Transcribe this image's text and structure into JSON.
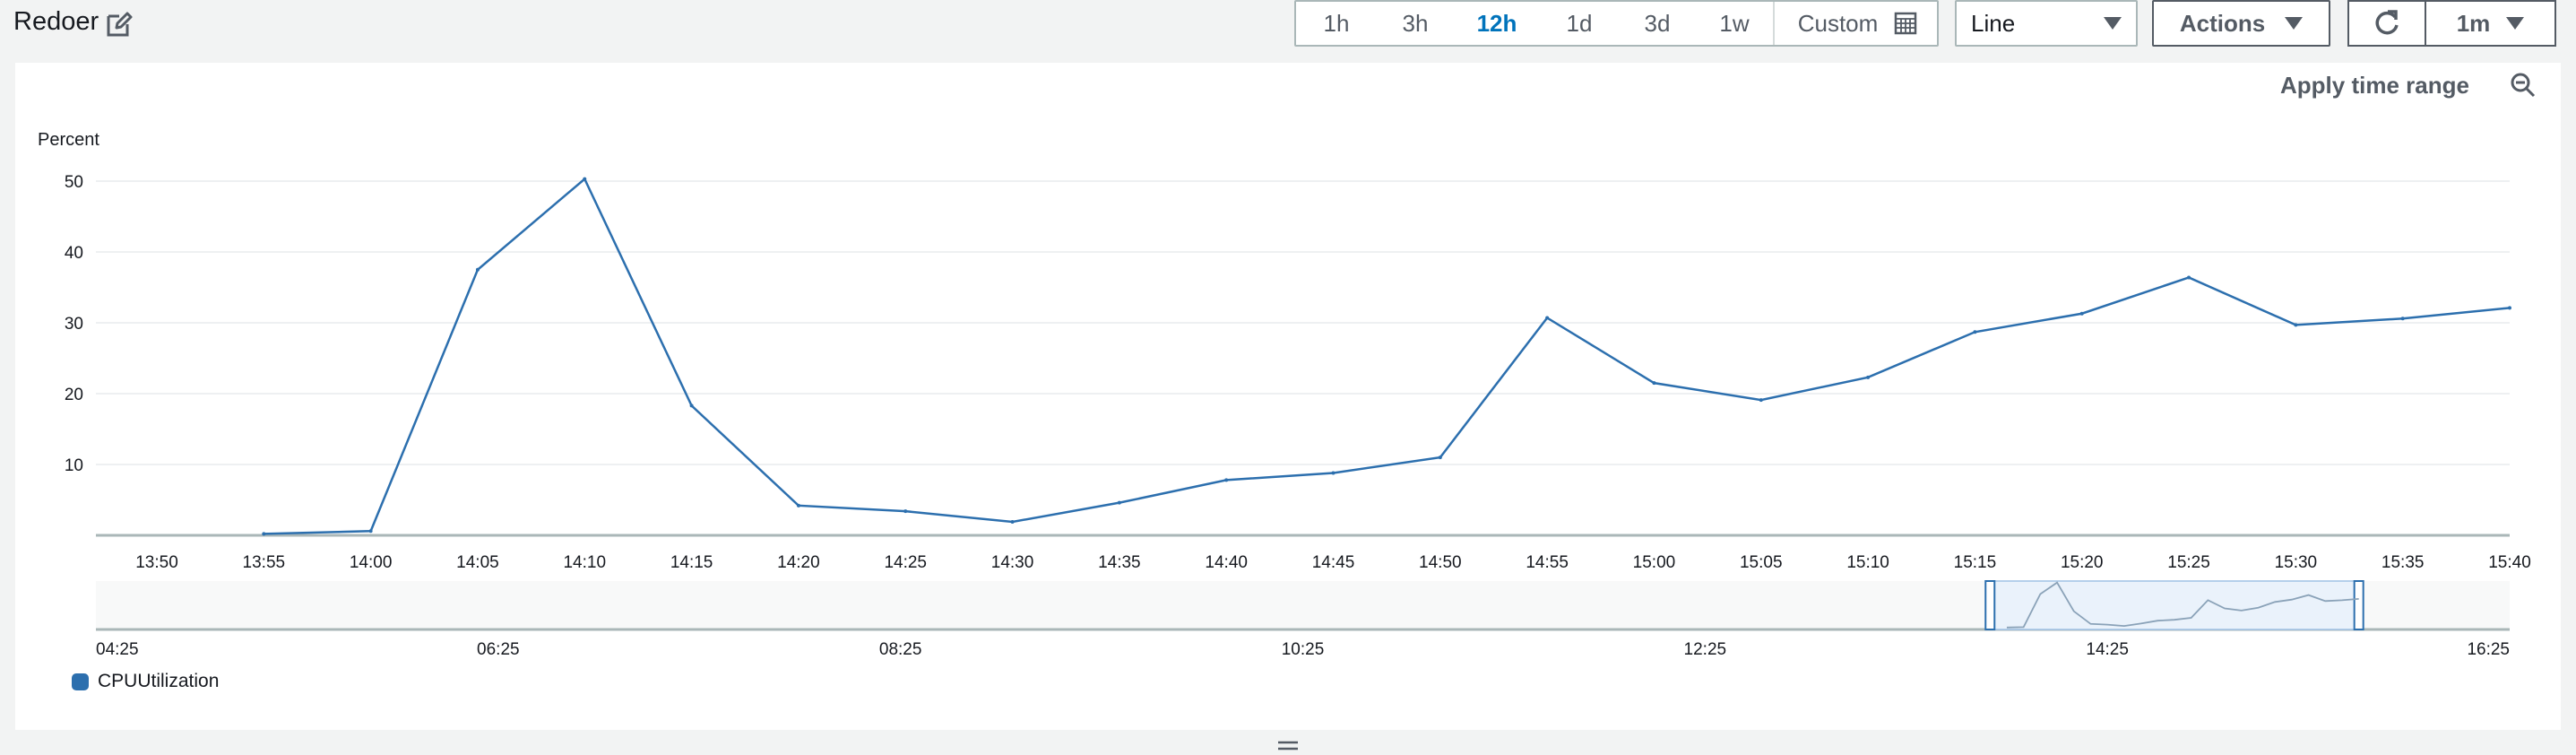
{
  "header": {
    "title": "Redoer"
  },
  "toolbar": {
    "ranges": [
      "1h",
      "3h",
      "12h",
      "1d",
      "3d",
      "1w"
    ],
    "active_range": "12h",
    "custom_label": "Custom",
    "chart_type": "Line",
    "actions_label": "Actions",
    "period": "1m"
  },
  "panel": {
    "apply_time_range": "Apply time range"
  },
  "colors": {
    "series": "#2c6fae",
    "active": "#0073bb"
  },
  "chart_data": {
    "type": "line",
    "ylabel": "Percent",
    "y_ticks": [
      10,
      20,
      30,
      40,
      50
    ],
    "ylim": [
      0,
      50
    ],
    "x_ticks": [
      "13:50",
      "13:55",
      "14:00",
      "14:05",
      "14:10",
      "14:15",
      "14:20",
      "14:25",
      "14:30",
      "14:35",
      "14:40",
      "14:45",
      "14:50",
      "14:55",
      "15:00",
      "15:05",
      "15:10",
      "15:15",
      "15:20",
      "15:25",
      "15:30",
      "15:35",
      "15:40"
    ],
    "series": [
      {
        "name": "CPUUtilization",
        "x": [
          "13:55",
          "14:00",
          "14:05",
          "14:10",
          "14:15",
          "14:20",
          "14:25",
          "14:30",
          "14:35",
          "14:40",
          "14:45",
          "14:50",
          "14:55",
          "15:00",
          "15:05",
          "15:10",
          "15:15",
          "15:20",
          "15:25",
          "15:30",
          "15:35",
          "15:40"
        ],
        "values": [
          0.2,
          0.6,
          37.5,
          50.3,
          18.3,
          4.2,
          3.4,
          1.9,
          4.6,
          7.8,
          8.8,
          11.0,
          30.7,
          21.5,
          19.1,
          22.3,
          28.7,
          31.3,
          36.4,
          29.7,
          30.6,
          32.1
        ]
      }
    ],
    "overview_ticks": [
      "04:25",
      "06:25",
      "08:25",
      "10:25",
      "12:25",
      "14:25",
      "16:25"
    ],
    "overview_selection": [
      "13:50",
      "15:40"
    ],
    "legend_position": "bottom-left"
  }
}
